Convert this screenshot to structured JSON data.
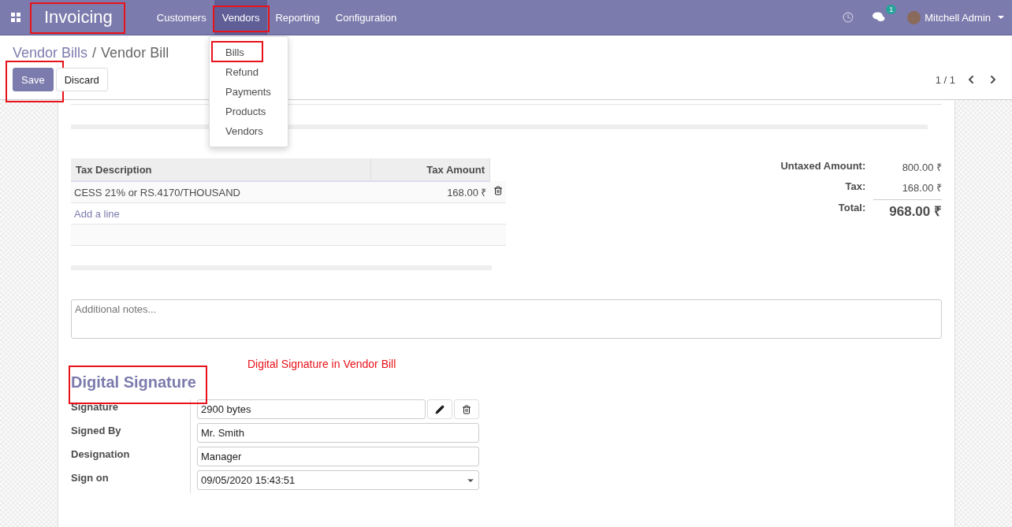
{
  "navbar": {
    "app_name": "Invoicing",
    "app_name_highlighted": true,
    "menu": [
      {
        "label": "Customers",
        "selected": false,
        "highlighted": false
      },
      {
        "label": "Vendors",
        "selected": true,
        "highlighted": true
      },
      {
        "label": "Reporting",
        "selected": false,
        "highlighted": false
      },
      {
        "label": "Configuration",
        "selected": false,
        "highlighted": false
      }
    ],
    "messages_badge": "1",
    "user": "Mitchell Admin"
  },
  "dropdown": [
    {
      "label": "Bills",
      "highlighted": true
    },
    {
      "label": "Refund",
      "highlighted": false
    },
    {
      "label": "Payments",
      "highlighted": false
    },
    {
      "label": "Products",
      "highlighted": false
    },
    {
      "label": "Vendors",
      "highlighted": false
    }
  ],
  "breadcrumb": {
    "parent": "Vendor Bills",
    "separator": "/",
    "current": "Vendor Bill"
  },
  "buttons": [
    {
      "label": "Save",
      "kind": "primary",
      "highlighted": true
    },
    {
      "label": "Discard",
      "kind": "secondary",
      "highlighted": false
    }
  ],
  "pager": "1 / 1",
  "tax_table": {
    "columns": [
      "Tax Description",
      "Tax Amount"
    ],
    "rows": [
      {
        "description": "CESS 21% or RS.4170/THOUSAND",
        "amount": "168.00 ₹"
      }
    ],
    "add_line": "Add a line"
  },
  "totals": [
    {
      "label": "Untaxed Amount:",
      "value": "800.00 ₹",
      "kind": "line"
    },
    {
      "label": "Tax:",
      "value": "168.00 ₹",
      "kind": "line"
    },
    {
      "label": "Total:",
      "value": "968.00 ₹",
      "kind": "total"
    }
  ],
  "notes": {
    "placeholder": "Additional notes..."
  },
  "annotation": "Digital Signature in Vendor Bill",
  "signature_section": {
    "title": "Digital Signature",
    "title_highlighted": true,
    "fields": [
      {
        "label": "Signature",
        "value": "2900 bytes",
        "kind": "binary"
      },
      {
        "label": "Signed By",
        "value": "Mr. Smith",
        "kind": "text"
      },
      {
        "label": "Designation",
        "value": "Manager",
        "kind": "text"
      },
      {
        "label": "Sign on",
        "value": "09/05/2020 15:43:51",
        "kind": "datetime"
      }
    ]
  }
}
